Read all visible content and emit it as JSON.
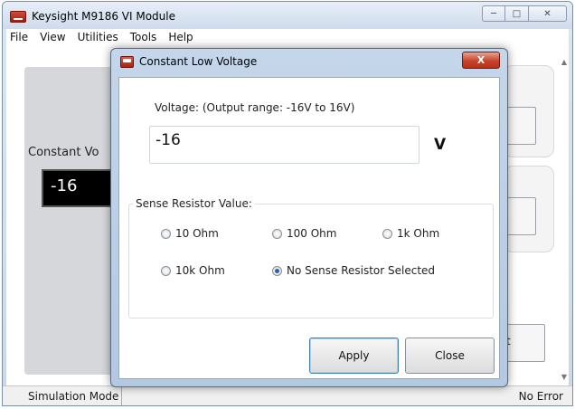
{
  "main_window": {
    "title": "Keysight M9186 VI Module",
    "menu": [
      "File",
      "View",
      "Utilities",
      "Tools",
      "Help"
    ],
    "constant_voltage_label": "Constant Vo",
    "constant_voltage_value": "-16",
    "right_button_label": "t",
    "status_left": "Simulation Mode",
    "status_right": "No Error"
  },
  "dialog": {
    "title": "Constant Low Voltage",
    "close_glyph": "X",
    "voltage_label": "Voltage: (Output range: -16V to 16V)",
    "voltage_value": "-16",
    "voltage_unit": "V",
    "sense_group_label": "Sense Resistor Value:",
    "sense_options": [
      {
        "label": "10 Ohm",
        "selected": false
      },
      {
        "label": "100 Ohm",
        "selected": false
      },
      {
        "label": "1k Ohm",
        "selected": false
      },
      {
        "label": "10k Ohm",
        "selected": false
      },
      {
        "label": "No Sense Resistor Selected",
        "selected": true
      }
    ],
    "apply_label": "Apply",
    "close_label": "Close"
  }
}
